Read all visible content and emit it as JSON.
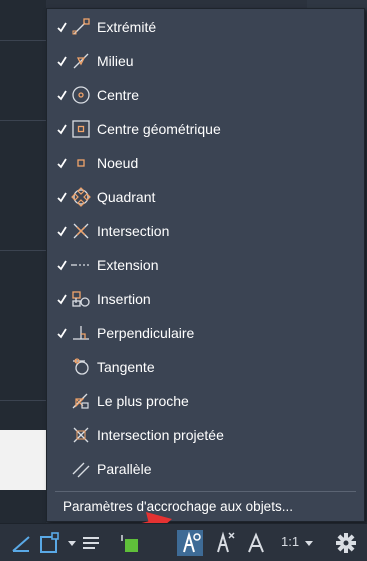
{
  "menu": {
    "items": [
      {
        "label": "Extrémité",
        "checked": true,
        "icon": "endpoint-icon"
      },
      {
        "label": "Milieu",
        "checked": true,
        "icon": "midpoint-icon"
      },
      {
        "label": "Centre",
        "checked": true,
        "icon": "center-icon"
      },
      {
        "label": "Centre géométrique",
        "checked": true,
        "icon": "geometric-center-icon"
      },
      {
        "label": "Noeud",
        "checked": true,
        "icon": "node-icon"
      },
      {
        "label": "Quadrant",
        "checked": true,
        "icon": "quadrant-icon"
      },
      {
        "label": "Intersection",
        "checked": true,
        "icon": "intersection-icon"
      },
      {
        "label": "Extension",
        "checked": true,
        "icon": "extension-icon"
      },
      {
        "label": "Insertion",
        "checked": true,
        "icon": "insertion-icon"
      },
      {
        "label": "Perpendiculaire",
        "checked": true,
        "icon": "perpendicular-icon"
      },
      {
        "label": "Tangente",
        "checked": false,
        "icon": "tangent-icon"
      },
      {
        "label": "Le plus proche",
        "checked": false,
        "icon": "nearest-icon"
      },
      {
        "label": "Intersection projetée",
        "checked": false,
        "icon": "apparent-intersection-icon"
      },
      {
        "label": "Parallèle",
        "checked": false,
        "icon": "parallel-icon"
      }
    ],
    "settings_label": "Paramètres d'accrochage aux objets..."
  },
  "statusbar": {
    "scale_label": "1:1"
  },
  "colors": {
    "menu_bg": "#3b4453",
    "icon_accent": "#f0a36a",
    "icon_blue": "#5aa9e6",
    "icon_green": "#5fbf3a",
    "arrow_red": "#e53232"
  }
}
